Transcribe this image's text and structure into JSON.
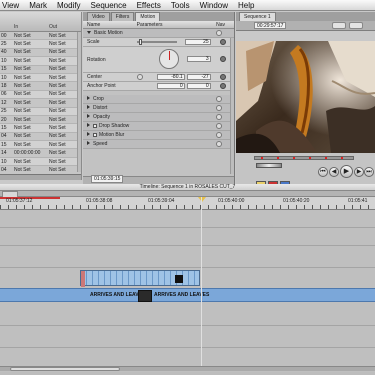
{
  "menu": [
    "View",
    "Mark",
    "Modify",
    "Sequence",
    "Effects",
    "Tools",
    "Window",
    "Help"
  ],
  "browser": {
    "headers": [
      "",
      "In",
      "Out"
    ],
    "rows": [
      {
        "n": "00",
        "in": "Not Set",
        "out": "Not Set"
      },
      {
        "n": "25",
        "in": "Not Set",
        "out": "Not Set"
      },
      {
        "n": "40",
        "in": "Not Set",
        "out": "Not Set"
      },
      {
        "n": "10",
        "in": "Not Set",
        "out": "Not Set"
      },
      {
        "n": "15",
        "in": "Not Set",
        "out": "Not Set"
      },
      {
        "n": "10",
        "in": "Not Set",
        "out": "Not Set"
      },
      {
        "n": "18",
        "in": "Not Set",
        "out": "Not Set"
      },
      {
        "n": "06",
        "in": "Not Set",
        "out": "Not Set"
      },
      {
        "n": "12",
        "in": "Not Set",
        "out": "Not Set"
      },
      {
        "n": "25",
        "in": "Not Set",
        "out": "Not Set"
      },
      {
        "n": "20",
        "in": "Not Set",
        "out": "Not Set"
      },
      {
        "n": "15",
        "in": "Not Set",
        "out": "Not Set"
      },
      {
        "n": "04",
        "in": "Not Set",
        "out": "Not Set"
      },
      {
        "n": "15",
        "in": "Not Set",
        "out": "Not Set"
      },
      {
        "n": "14",
        "in": "00:00:00:00",
        "out": "Not Set"
      },
      {
        "n": "10",
        "in": "Not Set",
        "out": "Not Set"
      },
      {
        "n": "04",
        "in": "Not Set",
        "out": "Not Set"
      }
    ]
  },
  "viewer": {
    "tabs": [
      "Video",
      "Filters",
      "Motion"
    ],
    "active_tab": "Motion",
    "columns": {
      "name": "Name",
      "parameters": "Parameters",
      "nav": "Nav"
    },
    "section_basic": "Basic Motion",
    "scale_label": "Scale",
    "scale_value": "25",
    "rotation_label": "Rotation",
    "rotation_value": "3",
    "center_label": "Center",
    "center_x": "-80.1",
    "center_y": "-27",
    "anchor_label": "Anchor Point",
    "anchor_x": "0",
    "anchor_y": "0",
    "sections": [
      "Crop",
      "Distort",
      "Opacity",
      "Drop Shadow",
      "Motion Blur",
      "Speed"
    ],
    "timecode": "01:05:39:15"
  },
  "canvas": {
    "tab": "Sequence 1",
    "timecode": "00:29:57:17"
  },
  "timeline": {
    "title": "Timeline: Sequence 1 in ROSALES CUT_7",
    "ruler": [
      "01:05:37:12",
      "01:05:38:08",
      "01:05:39:04",
      "01:05:40:00",
      "01:05:40:20",
      "01:05:41"
    ],
    "clip_label_1": "ARRIVES AND LEAVES",
    "clip_label_2": "ARRIVES AND LEAVES"
  },
  "colors": {
    "clip_video": "#7ba7d9",
    "clip_audio": "#9fc3e6",
    "marker": "#d22222",
    "playhead_head": "#e8c24a"
  }
}
